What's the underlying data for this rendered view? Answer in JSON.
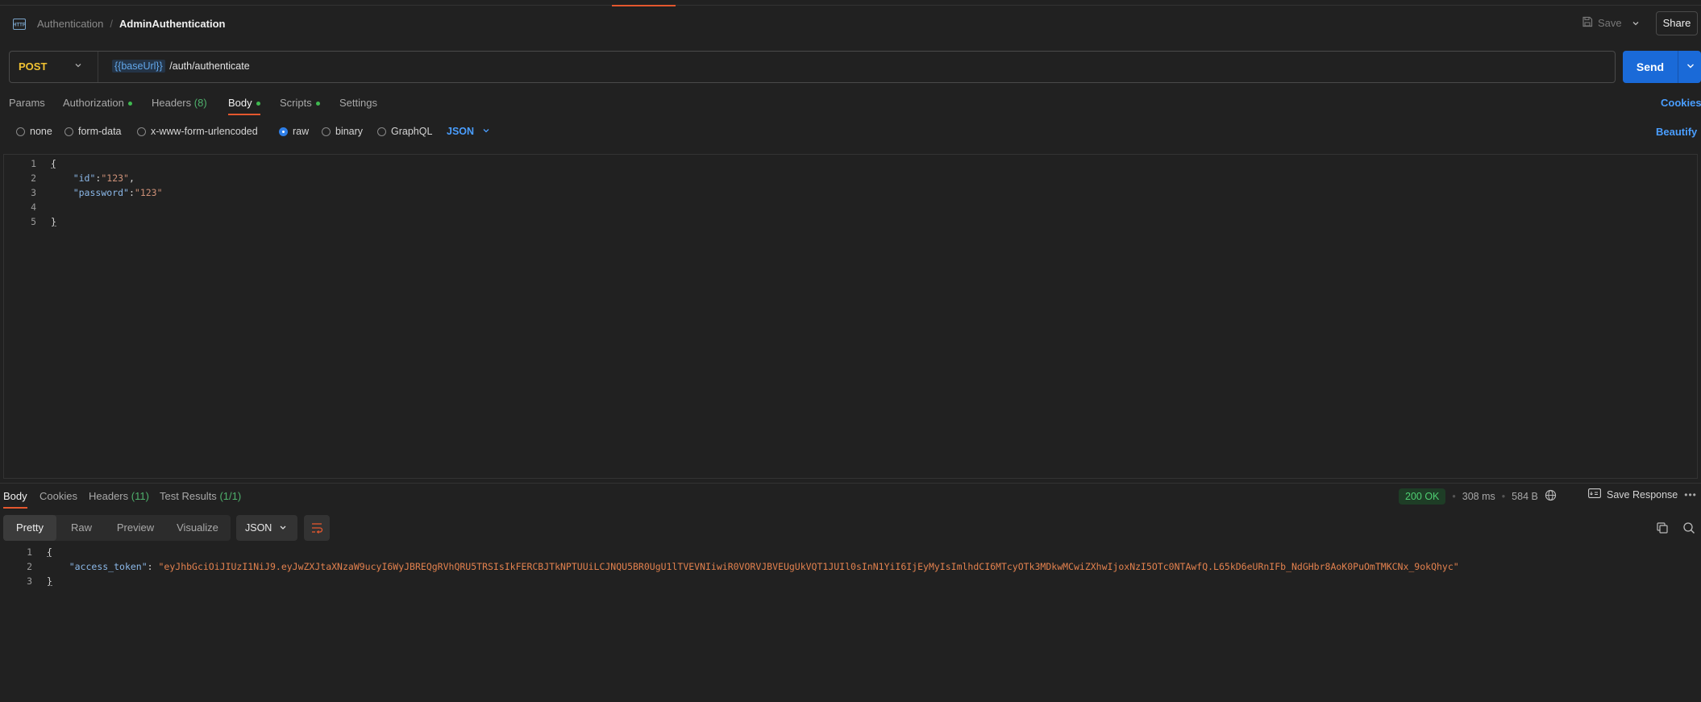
{
  "header": {
    "icon_text": "HTTP",
    "breadcrumb_parent": "Authentication",
    "breadcrumb_sep": "/",
    "breadcrumb_current": "AdminAuthentication",
    "save_label": "Save",
    "share_label": "Share"
  },
  "request": {
    "method": "POST",
    "url_variable": "{{baseUrl}}",
    "url_path": "/auth/authenticate",
    "send_label": "Send"
  },
  "request_tabs": [
    {
      "label": "Params",
      "count": "",
      "dot": false,
      "active": false
    },
    {
      "label": "Authorization",
      "count": "",
      "dot": true,
      "active": false
    },
    {
      "label": "Headers",
      "count": "(8)",
      "dot": false,
      "active": false
    },
    {
      "label": "Body",
      "count": "",
      "dot": true,
      "active": true
    },
    {
      "label": "Scripts",
      "count": "",
      "dot": true,
      "active": false
    },
    {
      "label": "Settings",
      "count": "",
      "dot": false,
      "active": false
    }
  ],
  "cookies_label": "Cookies",
  "body_types": [
    {
      "label": "none",
      "selected": false
    },
    {
      "label": "form-data",
      "selected": false
    },
    {
      "label": "x-www-form-urlencoded",
      "selected": false
    },
    {
      "label": "raw",
      "selected": true
    },
    {
      "label": "binary",
      "selected": false
    },
    {
      "label": "GraphQL",
      "selected": false
    }
  ],
  "raw_format": "JSON",
  "beautify_label": "Beautify",
  "request_body": {
    "line_numbers": [
      "1",
      "2",
      "3",
      "4",
      "5"
    ],
    "open_brace": "{",
    "close_brace": "}",
    "id_key": "\"id\"",
    "id_value": "\"123\"",
    "password_key": "\"password\"",
    "password_value": "\"123\""
  },
  "response_tabs": [
    {
      "label": "Body",
      "count": "",
      "active": true
    },
    {
      "label": "Cookies",
      "count": "",
      "active": false
    },
    {
      "label": "Headers",
      "count": "(11)",
      "active": false
    },
    {
      "label": "Test Results",
      "count": "(1/1)",
      "active": false
    }
  ],
  "response_meta": {
    "status": "200 OK",
    "time": "308 ms",
    "size": "584 B",
    "save_response_label": "Save Response"
  },
  "response_views": [
    "Pretty",
    "Raw",
    "Preview",
    "Visualize"
  ],
  "response_format": "JSON",
  "response_body": {
    "line_numbers": [
      "1",
      "2",
      "3"
    ],
    "open_brace": "{",
    "close_brace": "}",
    "token_key": "\"access_token\"",
    "token_value": "\"eyJhbGciOiJIUzI1NiJ9.eyJwZXJtaXNzaW9ucyI6WyJBREQgRVhQRU5TRSIsIkFERCBJTkNPTUUiLCJNQU5BR0UgU1lTVEVNIiwiR0VORVJBVEUgUkVQT1JUIl0sInN1YiI6IjEyMyIsImlhdCI6MTcyOTk3MDkwMCwiZXhwIjoxNzI5OTc0NTAwfQ.L65kD6eURnIFb_NdGHbr8AoK0PuOmTMKCNx_9okQhyc\""
  },
  "colors": {
    "accent": "#e4572e",
    "send": "#1a6ad8",
    "method": "#f1c232",
    "link": "#4a9eff",
    "status_ok": "#4fcf72"
  }
}
